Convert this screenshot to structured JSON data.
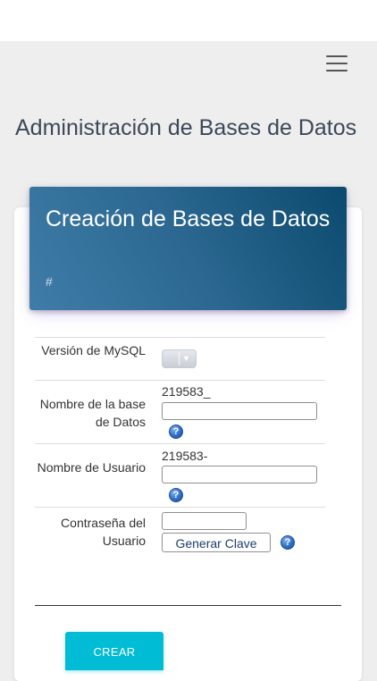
{
  "page": {
    "title": "Administración de Bases de Datos"
  },
  "card": {
    "title": "Creación de Bases de Datos",
    "category": "#"
  },
  "form": {
    "mysql_version": {
      "label": "Versión de MySQL",
      "selected_value": "",
      "icon": "chevron-down-icon"
    },
    "db_name": {
      "label": "Nombre de la base de Datos",
      "prefix": "219583_",
      "value": "",
      "help_icon": "help-icon"
    },
    "user_name": {
      "label": "Nombre de Usuario",
      "prefix": "219583-",
      "value": "",
      "help_icon": "help-icon"
    },
    "password": {
      "label": "Contraseña del Usuario",
      "value": "",
      "generate_label": "Generar Clave",
      "help_icon": "help-icon"
    },
    "submit_label": "CREAR"
  },
  "colors": {
    "header_gradient_start": "#3f7da8",
    "header_gradient_end": "#0b4a6e",
    "submit_button": "#00bcd4",
    "page_background": "#eeeeee",
    "help_icon": "#2f6ec9"
  }
}
